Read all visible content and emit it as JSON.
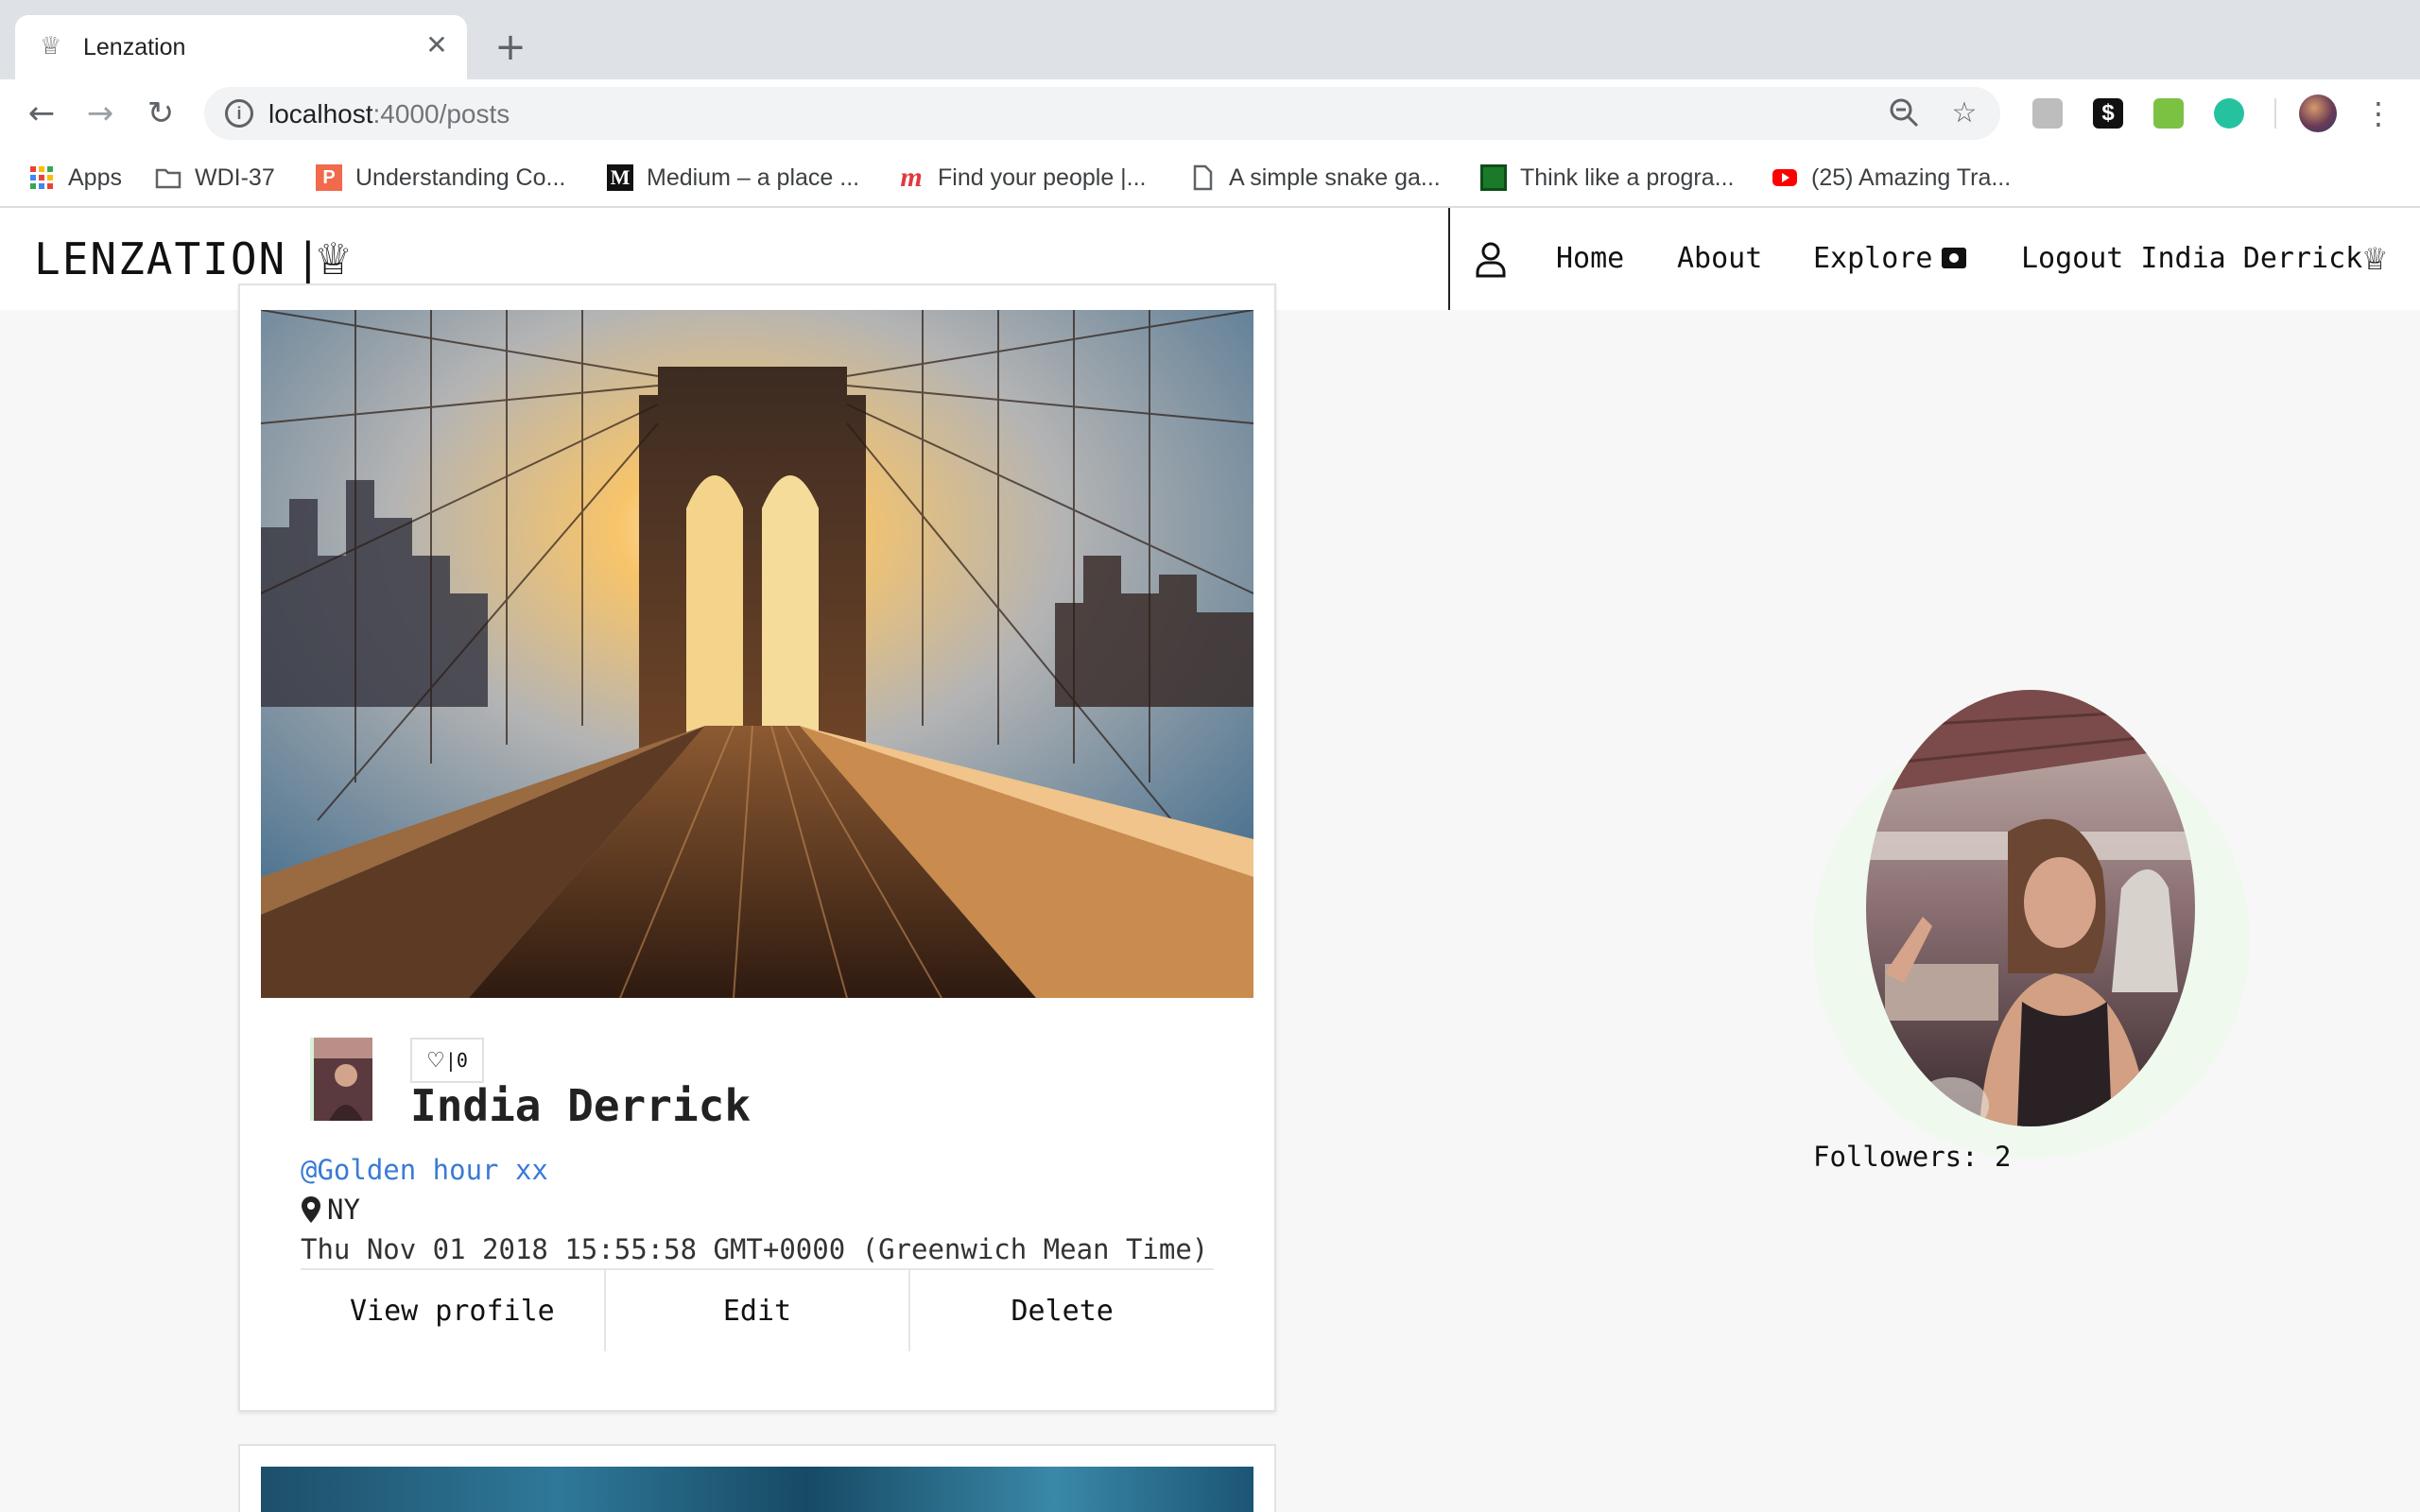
{
  "browser": {
    "tab_title": "Lenzation",
    "tab_favicon": "crown-icon",
    "new_tab_icon": "plus-icon",
    "url_host": "localhost",
    "url_path": ":4000/posts",
    "bookmarks": [
      {
        "label": "Apps",
        "icon": "apps-grid-icon"
      },
      {
        "label": "WDI-37",
        "icon": "folder-icon"
      },
      {
        "label": "Understanding Co...",
        "icon": "p-icon"
      },
      {
        "label": "Medium – a place ...",
        "icon": "medium-icon"
      },
      {
        "label": "Find your people |...",
        "icon": "meetup-icon"
      },
      {
        "label": "A simple snake ga...",
        "icon": "page-icon"
      },
      {
        "label": "Think like a progra...",
        "icon": "site-icon"
      },
      {
        "label": "(25) Amazing Tra...",
        "icon": "youtube-icon"
      }
    ]
  },
  "navbar": {
    "brand": "LENZATION",
    "brand_separator": "|",
    "links": {
      "home": "Home",
      "about": "About",
      "explore": "Explore",
      "logout": "Logout India Derrick"
    }
  },
  "post": {
    "author": "India Derrick",
    "likes_label": "|0",
    "caption": "@Golden hour xx",
    "location": "NY",
    "timestamp": "Thu Nov 01 2018 15:55:58 GMT+0000 (Greenwich Mean Time)",
    "actions": {
      "view_profile": "View profile",
      "edit": "Edit",
      "delete": "Delete"
    }
  },
  "sidebar": {
    "followers": "Followers: 2"
  },
  "colors": {
    "page_bg": "#f7f7f7",
    "link_blue": "#3a7bd5",
    "halo_green": "#f0f9ee"
  }
}
